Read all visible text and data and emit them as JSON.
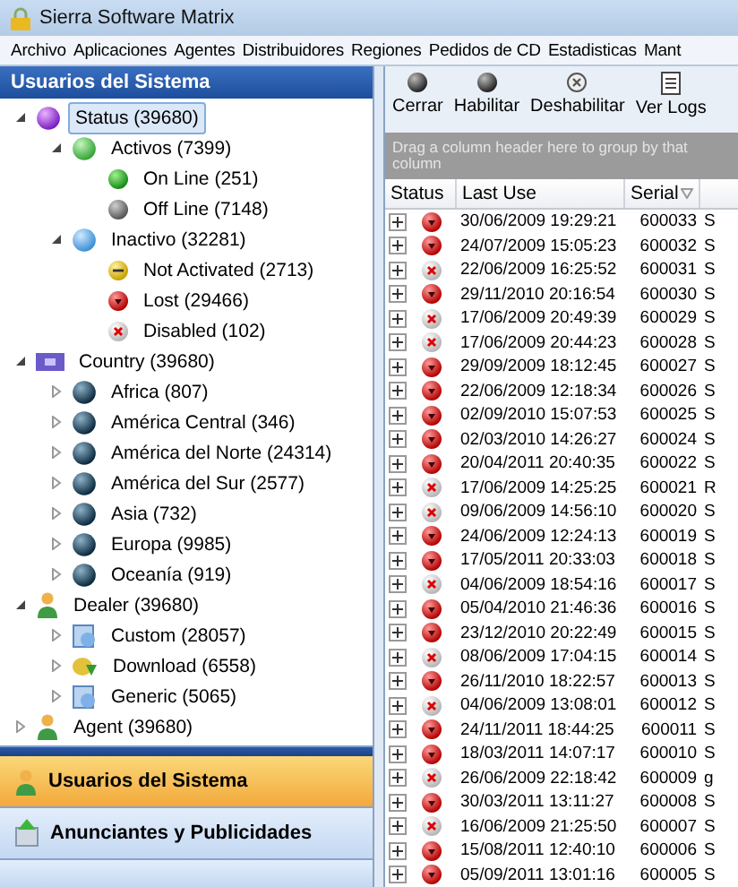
{
  "window": {
    "title": "Sierra Software Matrix"
  },
  "menu": [
    "Archivo",
    "Aplicaciones",
    "Agentes",
    "Distribuidores",
    "Regiones",
    "Pedidos de CD",
    "Estadisticas",
    "Mant"
  ],
  "sidebar": {
    "title": "Usuarios del Sistema",
    "tree": [
      {
        "label": "Status (39680)",
        "kind": "status",
        "expanded": true,
        "selected": true,
        "children": [
          {
            "label": "Activos (7399)",
            "kind": "active",
            "expanded": true,
            "selected": false,
            "children": [
              {
                "label": "On Line (251)",
                "kind": "online",
                "selected": false
              },
              {
                "label": "Off Line (7148)",
                "kind": "offline",
                "selected": false
              }
            ]
          },
          {
            "label": "Inactivo (32281)",
            "kind": "inactive",
            "expanded": true,
            "selected": false,
            "children": [
              {
                "label": "Not Activated (2713)",
                "kind": "notactivated",
                "selected": false
              },
              {
                "label": "Lost (29466)",
                "kind": "lost",
                "selected": false
              },
              {
                "label": "Disabled (102)",
                "kind": "disabled",
                "selected": false
              }
            ]
          }
        ]
      },
      {
        "label": "Country (39680)",
        "kind": "country",
        "expanded": true,
        "selected": false,
        "children": [
          {
            "label": "Africa (807)",
            "kind": "globe",
            "expanded": false,
            "selected": false
          },
          {
            "label": "América Central (346)",
            "kind": "globe",
            "expanded": false,
            "selected": false
          },
          {
            "label": "América del Norte (24314)",
            "kind": "globe",
            "expanded": false,
            "selected": false
          },
          {
            "label": "América del Sur (2577)",
            "kind": "globe",
            "expanded": false,
            "selected": false
          },
          {
            "label": "Asia (732)",
            "kind": "globe",
            "expanded": false,
            "selected": false
          },
          {
            "label": "Europa (9985)",
            "kind": "globe",
            "expanded": false,
            "selected": false
          },
          {
            "label": "Oceanía (919)",
            "kind": "globe",
            "expanded": false,
            "selected": false
          }
        ]
      },
      {
        "label": "Dealer (39680)",
        "kind": "person",
        "expanded": true,
        "selected": false,
        "children": [
          {
            "label": "Custom (28057)",
            "kind": "package",
            "expanded": false,
            "selected": false
          },
          {
            "label": "Download (6558)",
            "kind": "download",
            "expanded": false,
            "selected": false
          },
          {
            "label": "Generic (5065)",
            "kind": "package",
            "expanded": false,
            "selected": false
          }
        ]
      },
      {
        "label": "Agent (39680)",
        "kind": "person",
        "expanded": false,
        "selected": false
      }
    ],
    "nav": [
      {
        "label": "Usuarios del Sistema",
        "kind": "person",
        "selected": true
      },
      {
        "label": "Anunciantes y Publicidades",
        "kind": "upload",
        "selected": false
      }
    ]
  },
  "toolbar": [
    {
      "label": "Cerrar",
      "kind": "dark"
    },
    {
      "label": "Habilitar",
      "kind": "dark"
    },
    {
      "label": "Deshabilitar",
      "kind": "disabled"
    },
    {
      "label": "Ver Logs",
      "kind": "log"
    }
  ],
  "table": {
    "group_hint": "Drag a column header here to group by that column",
    "columns": [
      "Status",
      "Last Use",
      "Serial"
    ],
    "rows": [
      {
        "kind": "lost",
        "last_use": "30/06/2009 19:29:21",
        "serial": "600033",
        "column_4": "S"
      },
      {
        "kind": "lost",
        "last_use": "24/07/2009 15:05:23",
        "serial": "600032",
        "column_4": "S"
      },
      {
        "kind": "disabled",
        "last_use": "22/06/2009 16:25:52",
        "serial": "600031",
        "column_4": "S"
      },
      {
        "kind": "lost",
        "last_use": "29/11/2010 20:16:54",
        "serial": "600030",
        "column_4": "S"
      },
      {
        "kind": "disabled",
        "last_use": "17/06/2009 20:49:39",
        "serial": "600029",
        "column_4": "S"
      },
      {
        "kind": "disabled",
        "last_use": "17/06/2009 20:44:23",
        "serial": "600028",
        "column_4": "S"
      },
      {
        "kind": "lost",
        "last_use": "29/09/2009 18:12:45",
        "serial": "600027",
        "column_4": "S"
      },
      {
        "kind": "lost",
        "last_use": "22/06/2009 12:18:34",
        "serial": "600026",
        "column_4": "S"
      },
      {
        "kind": "lost",
        "last_use": "02/09/2010 15:07:53",
        "serial": "600025",
        "column_4": "S"
      },
      {
        "kind": "lost",
        "last_use": "02/03/2010 14:26:27",
        "serial": "600024",
        "column_4": "S"
      },
      {
        "kind": "lost",
        "last_use": "20/04/2011 20:40:35",
        "serial": "600022",
        "column_4": "S"
      },
      {
        "kind": "disabled",
        "last_use": "17/06/2009 14:25:25",
        "serial": "600021",
        "column_4": "R"
      },
      {
        "kind": "disabled",
        "last_use": "09/06/2009 14:56:10",
        "serial": "600020",
        "column_4": "S"
      },
      {
        "kind": "lost",
        "last_use": "24/06/2009 12:24:13",
        "serial": "600019",
        "column_4": "S"
      },
      {
        "kind": "lost",
        "last_use": "17/05/2011 20:33:03",
        "serial": "600018",
        "column_4": "S"
      },
      {
        "kind": "disabled",
        "last_use": "04/06/2009 18:54:16",
        "serial": "600017",
        "column_4": "S"
      },
      {
        "kind": "lost",
        "last_use": "05/04/2010 21:46:36",
        "serial": "600016",
        "column_4": "S"
      },
      {
        "kind": "lost",
        "last_use": "23/12/2010 20:22:49",
        "serial": "600015",
        "column_4": "S"
      },
      {
        "kind": "disabled",
        "last_use": "08/06/2009 17:04:15",
        "serial": "600014",
        "column_4": "S"
      },
      {
        "kind": "lost",
        "last_use": "26/11/2010 18:22:57",
        "serial": "600013",
        "column_4": "S"
      },
      {
        "kind": "disabled",
        "last_use": "04/06/2009 13:08:01",
        "serial": "600012",
        "column_4": "S"
      },
      {
        "kind": "lost",
        "last_use": "24/11/2011 18:44:25",
        "serial": "600011",
        "column_4": "S"
      },
      {
        "kind": "lost",
        "last_use": "18/03/2011 14:07:17",
        "serial": "600010",
        "column_4": "S"
      },
      {
        "kind": "disabled",
        "last_use": "26/06/2009 22:18:42",
        "serial": "600009",
        "column_4": "g"
      },
      {
        "kind": "lost",
        "last_use": "30/03/2011 13:11:27",
        "serial": "600008",
        "column_4": "S"
      },
      {
        "kind": "disabled",
        "last_use": "16/06/2009 21:25:50",
        "serial": "600007",
        "column_4": "S"
      },
      {
        "kind": "lost",
        "last_use": "15/08/2011 12:40:10",
        "serial": "600006",
        "column_4": "S"
      },
      {
        "kind": "lost",
        "last_use": "05/09/2011 13:01:16",
        "serial": "600005",
        "column_4": "S"
      }
    ]
  }
}
